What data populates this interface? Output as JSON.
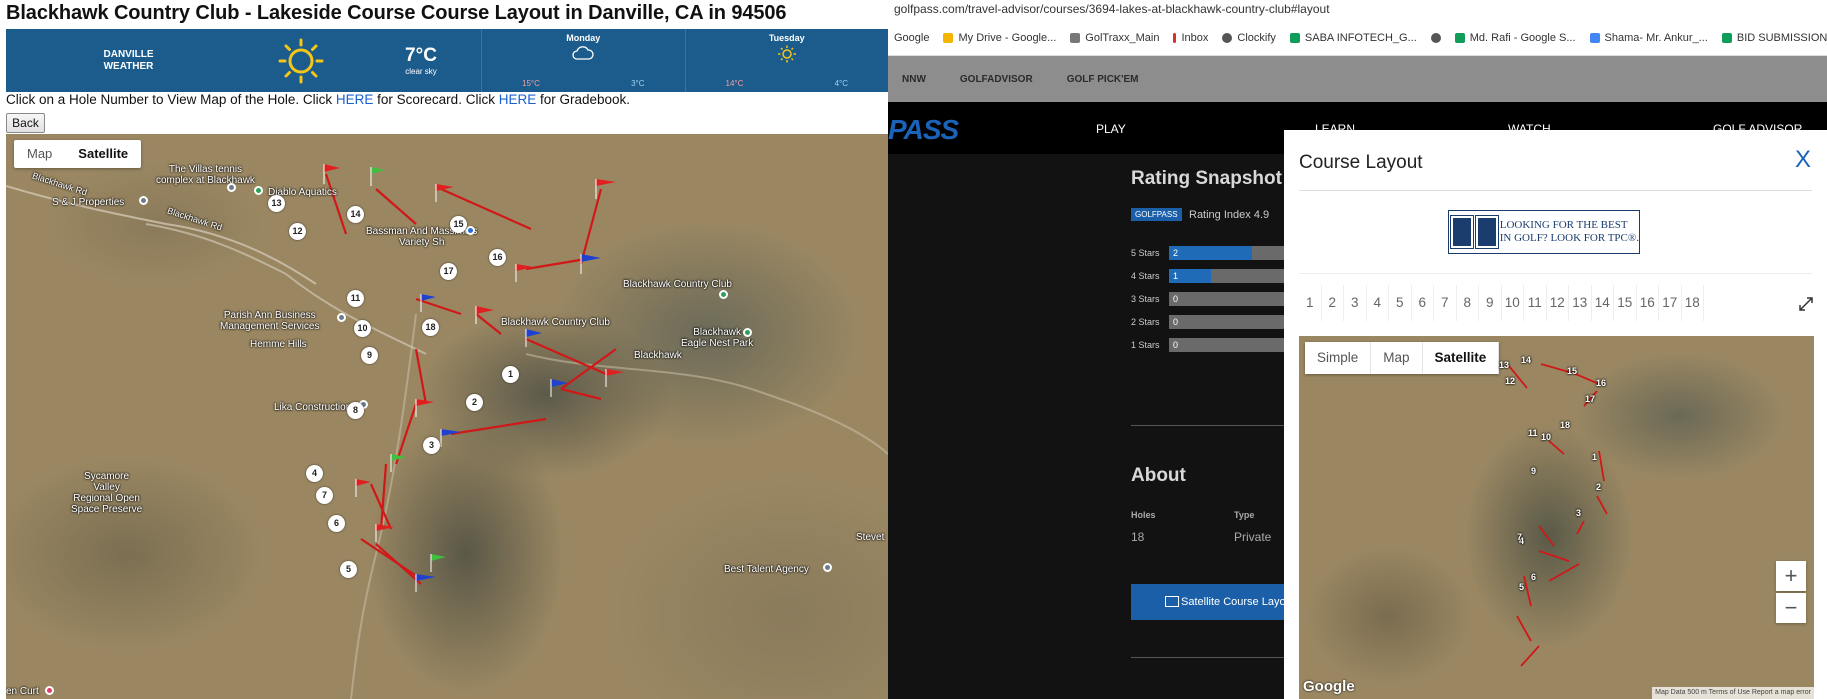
{
  "page": {
    "title": "Blackhawk Country Club - Lakeside Course Course Layout in Danville, CA in 94506"
  },
  "weather": {
    "city_line1": "DANVILLE",
    "city_line2": "WEATHER",
    "temp": "7°C",
    "condition": "clear sky",
    "days": [
      {
        "name": "Monday",
        "hi": "15°C",
        "lo": "3°C",
        "icon": "cloud-icon"
      },
      {
        "name": "Tuesday",
        "hi": "14°C",
        "lo": "4°C",
        "icon": "sun-icon"
      }
    ]
  },
  "instructions": {
    "part1": "Click on a Hole Number to View Map of the Hole. Click ",
    "link1": "HERE",
    "part2": " for Scorecard. Click ",
    "link2": "HERE",
    "part3": " for Gradebook."
  },
  "back_label": "Back",
  "map": {
    "tabs": [
      "Map",
      "Satellite"
    ],
    "active_tab": "Satellite",
    "labels": {
      "villas": "The Villas tennis\ncomplex at Blackhawk",
      "diablo": "Diablo Aquatics",
      "sj": "S & J Properties",
      "blackhawk_rd1": "Blackhawk Rd",
      "blackhawk_rd2": "Blackhawk Rd",
      "massimo": "Bassman And Massimo's\nVariety Sh",
      "parish": "Parish Ann Business\nManagement Services",
      "hemme": "Hemme Hills",
      "bcc": "Blackhawk Country Club",
      "bcc2": "Blackhawk Country Club",
      "eagle": "Blackhawk\nEagle Nest Park",
      "blackhawk": "Blackhawk",
      "lika": "Lika Construction",
      "sycamore": "Sycamore\nValley\nRegional Open\nSpace Preserve",
      "best": "Best Talent Agency",
      "stevet": "Stevet",
      "encurt": "en Curt"
    },
    "holes": [
      "1",
      "2",
      "3",
      "4",
      "5",
      "6",
      "7",
      "8",
      "9",
      "10",
      "11",
      "12",
      "13",
      "14",
      "15",
      "16",
      "17",
      "18"
    ]
  },
  "browser": {
    "url": "golfpass.com/travel-advisor/courses/3694-lakes-at-blackhawk-country-club#layout",
    "bookmarks": [
      "Google",
      "My Drive - Google...",
      "GolTraxx_Main",
      "Inbox",
      "Clockify",
      "SABA INFOTECH_G...",
      "Md. Rafi - Google S...",
      "Shama- Mr. Ankur_...",
      "BID SUBMISSION_D..."
    ]
  },
  "site": {
    "topnav": [
      "NNW",
      "GOLFADVISOR",
      "GOLF PICK'EM"
    ],
    "logo": "PASS",
    "mainnav": [
      "PLAY",
      "LEARN",
      "WATCH",
      "GOLF ADVISOR"
    ],
    "rating_title": "Rating Snapshot",
    "rating_badge": "GOLFPASS",
    "rating_index_label": "Rating Index",
    "rating_index_value": "4.9",
    "ratings": [
      {
        "label": "5 Stars",
        "count": "2",
        "fraction": 0.55
      },
      {
        "label": "4 Stars",
        "count": "1",
        "fraction": 0.28
      },
      {
        "label": "3 Stars",
        "count": "0",
        "fraction": 0.0
      },
      {
        "label": "2 Stars",
        "count": "0",
        "fraction": 0.0
      },
      {
        "label": "1 Stars",
        "count": "0",
        "fraction": 0.0
      }
    ],
    "about_title": "About",
    "holes_label": "Holes",
    "holes_value": "18",
    "type_label": "Type",
    "type_value": "Private",
    "satellite_btn": "Satellite Course Layout"
  },
  "modal": {
    "title": "Course Layout",
    "close": "X",
    "ad_text": "LOOKING FOR THE BEST\nIN GOLF? LOOK FOR TPC®.",
    "hole_tabs": [
      "1",
      "2",
      "3",
      "4",
      "5",
      "6",
      "7",
      "8",
      "9",
      "10",
      "11",
      "12",
      "13",
      "14",
      "15",
      "16",
      "17",
      "18"
    ],
    "map_tabs": [
      "Simple",
      "Map",
      "Satellite"
    ],
    "active_map_tab": "Satellite",
    "zoom_in": "+",
    "zoom_out": "−",
    "google": "Google",
    "attribution": "Map Data  500 m  Terms of Use  Report a map error"
  },
  "colors": {
    "weather_bg": "#1c5c8c",
    "link": "#1a5fd0",
    "accent": "#1a63b8",
    "route": "#d01818"
  }
}
